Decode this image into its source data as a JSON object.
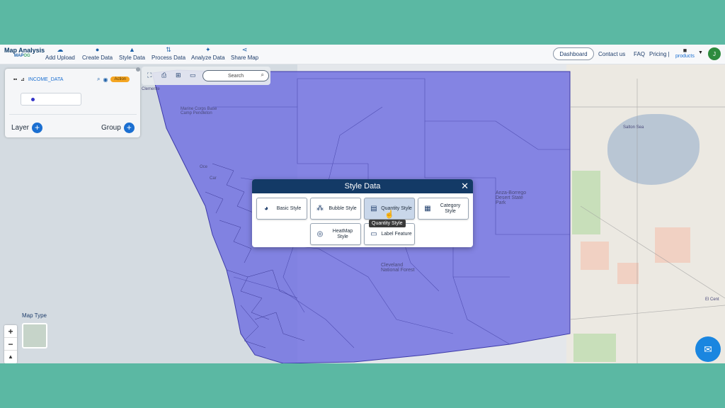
{
  "brand": {
    "title": "Map Analysis",
    "subtitle_a": "MAP",
    "subtitle_b": "OG"
  },
  "nav": [
    {
      "label": "Add Upload",
      "icon": "cloud-upload-icon"
    },
    {
      "label": "Create Data",
      "icon": "location-pin-icon"
    },
    {
      "label": "Style Data",
      "icon": "paint-icon"
    },
    {
      "label": "Process Data",
      "icon": "process-icon"
    },
    {
      "label": "Analyze Data",
      "icon": "analyze-icon"
    },
    {
      "label": "Share Map",
      "icon": "share-icon"
    }
  ],
  "topright": {
    "dashboard": "Dashboard",
    "contact": "Contact us",
    "faq": "FAQ",
    "pricing": "Pricing |",
    "products": "products",
    "avatar": "J"
  },
  "layer_panel": {
    "layer_name": "INCOME_DATA",
    "action": "Action",
    "layer_label": "Layer",
    "group_label": "Group"
  },
  "toolbar": {
    "search_placeholder": "Search"
  },
  "map": {
    "map_type_label": "Map Type",
    "labels": [
      "Clemente",
      "Marine Corps Base Camp Pendleton",
      "Salton Sea",
      "Anza-Borrego Desert State Park",
      "Cleveland National Forest",
      "El Cent",
      "Oce",
      "Car"
    ]
  },
  "modal": {
    "title": "Style Data",
    "options": [
      {
        "label": "Basic Style",
        "icon": "basic-style-icon"
      },
      {
        "label": "Bubble Style",
        "icon": "bubble-style-icon"
      },
      {
        "label": "Quantity Style",
        "icon": "quantity-style-icon"
      },
      {
        "label": "Category Style",
        "icon": "category-style-icon"
      },
      {
        "label": "HeatMap Style",
        "icon": "heatmap-style-icon"
      },
      {
        "label": "Label Feature",
        "icon": "label-feature-icon"
      }
    ],
    "tooltip": "Quantity Style"
  },
  "colors": {
    "accent": "#1b6fd1",
    "modal_header": "#133a66",
    "county_fill": "#6f6ee0",
    "frame_bg": "#5bb8a3"
  }
}
